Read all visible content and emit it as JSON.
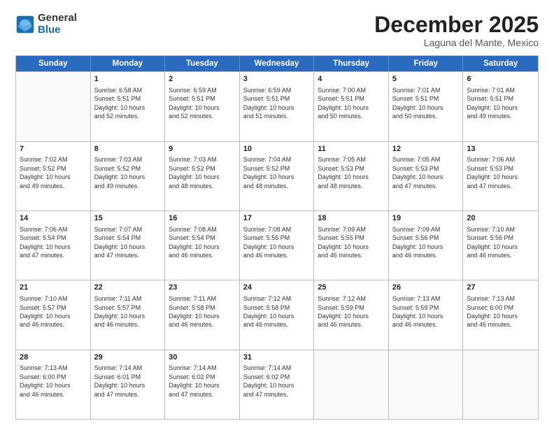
{
  "logo": {
    "general": "General",
    "blue": "Blue"
  },
  "title": "December 2025",
  "location": "Laguna del Mante, Mexico",
  "days_of_week": [
    "Sunday",
    "Monday",
    "Tuesday",
    "Wednesday",
    "Thursday",
    "Friday",
    "Saturday"
  ],
  "weeks": [
    [
      {
        "day": "",
        "text": ""
      },
      {
        "day": "1",
        "text": "Sunrise: 6:58 AM\nSunset: 5:51 PM\nDaylight: 10 hours\nand 52 minutes."
      },
      {
        "day": "2",
        "text": "Sunrise: 6:59 AM\nSunset: 5:51 PM\nDaylight: 10 hours\nand 52 minutes."
      },
      {
        "day": "3",
        "text": "Sunrise: 6:59 AM\nSunset: 5:51 PM\nDaylight: 10 hours\nand 51 minutes."
      },
      {
        "day": "4",
        "text": "Sunrise: 7:00 AM\nSunset: 5:51 PM\nDaylight: 10 hours\nand 50 minutes."
      },
      {
        "day": "5",
        "text": "Sunrise: 7:01 AM\nSunset: 5:51 PM\nDaylight: 10 hours\nand 50 minutes."
      },
      {
        "day": "6",
        "text": "Sunrise: 7:01 AM\nSunset: 5:51 PM\nDaylight: 10 hours\nand 49 minutes."
      }
    ],
    [
      {
        "day": "7",
        "text": "Sunrise: 7:02 AM\nSunset: 5:52 PM\nDaylight: 10 hours\nand 49 minutes."
      },
      {
        "day": "8",
        "text": "Sunrise: 7:03 AM\nSunset: 5:52 PM\nDaylight: 10 hours\nand 49 minutes."
      },
      {
        "day": "9",
        "text": "Sunrise: 7:03 AM\nSunset: 5:52 PM\nDaylight: 10 hours\nand 48 minutes."
      },
      {
        "day": "10",
        "text": "Sunrise: 7:04 AM\nSunset: 5:52 PM\nDaylight: 10 hours\nand 48 minutes."
      },
      {
        "day": "11",
        "text": "Sunrise: 7:05 AM\nSunset: 5:53 PM\nDaylight: 10 hours\nand 48 minutes."
      },
      {
        "day": "12",
        "text": "Sunrise: 7:05 AM\nSunset: 5:53 PM\nDaylight: 10 hours\nand 47 minutes."
      },
      {
        "day": "13",
        "text": "Sunrise: 7:06 AM\nSunset: 5:53 PM\nDaylight: 10 hours\nand 47 minutes."
      }
    ],
    [
      {
        "day": "14",
        "text": "Sunrise: 7:06 AM\nSunset: 5:54 PM\nDaylight: 10 hours\nand 47 minutes."
      },
      {
        "day": "15",
        "text": "Sunrise: 7:07 AM\nSunset: 5:54 PM\nDaylight: 10 hours\nand 47 minutes."
      },
      {
        "day": "16",
        "text": "Sunrise: 7:08 AM\nSunset: 5:54 PM\nDaylight: 10 hours\nand 46 minutes."
      },
      {
        "day": "17",
        "text": "Sunrise: 7:08 AM\nSunset: 5:55 PM\nDaylight: 10 hours\nand 46 minutes."
      },
      {
        "day": "18",
        "text": "Sunrise: 7:09 AM\nSunset: 5:55 PM\nDaylight: 10 hours\nand 46 minutes."
      },
      {
        "day": "19",
        "text": "Sunrise: 7:09 AM\nSunset: 5:56 PM\nDaylight: 10 hours\nand 46 minutes."
      },
      {
        "day": "20",
        "text": "Sunrise: 7:10 AM\nSunset: 5:56 PM\nDaylight: 10 hours\nand 46 minutes."
      }
    ],
    [
      {
        "day": "21",
        "text": "Sunrise: 7:10 AM\nSunset: 5:57 PM\nDaylight: 10 hours\nand 46 minutes."
      },
      {
        "day": "22",
        "text": "Sunrise: 7:11 AM\nSunset: 5:57 PM\nDaylight: 10 hours\nand 46 minutes."
      },
      {
        "day": "23",
        "text": "Sunrise: 7:11 AM\nSunset: 5:58 PM\nDaylight: 10 hours\nand 46 minutes."
      },
      {
        "day": "24",
        "text": "Sunrise: 7:12 AM\nSunset: 5:58 PM\nDaylight: 10 hours\nand 46 minutes."
      },
      {
        "day": "25",
        "text": "Sunrise: 7:12 AM\nSunset: 5:59 PM\nDaylight: 10 hours\nand 46 minutes."
      },
      {
        "day": "26",
        "text": "Sunrise: 7:13 AM\nSunset: 5:59 PM\nDaylight: 10 hours\nand 46 minutes."
      },
      {
        "day": "27",
        "text": "Sunrise: 7:13 AM\nSunset: 6:00 PM\nDaylight: 10 hours\nand 46 minutes."
      }
    ],
    [
      {
        "day": "28",
        "text": "Sunrise: 7:13 AM\nSunset: 6:00 PM\nDaylight: 10 hours\nand 46 minutes."
      },
      {
        "day": "29",
        "text": "Sunrise: 7:14 AM\nSunset: 6:01 PM\nDaylight: 10 hours\nand 47 minutes."
      },
      {
        "day": "30",
        "text": "Sunrise: 7:14 AM\nSunset: 6:02 PM\nDaylight: 10 hours\nand 47 minutes."
      },
      {
        "day": "31",
        "text": "Sunrise: 7:14 AM\nSunset: 6:02 PM\nDaylight: 10 hours\nand 47 minutes."
      },
      {
        "day": "",
        "text": ""
      },
      {
        "day": "",
        "text": ""
      },
      {
        "day": "",
        "text": ""
      }
    ]
  ]
}
